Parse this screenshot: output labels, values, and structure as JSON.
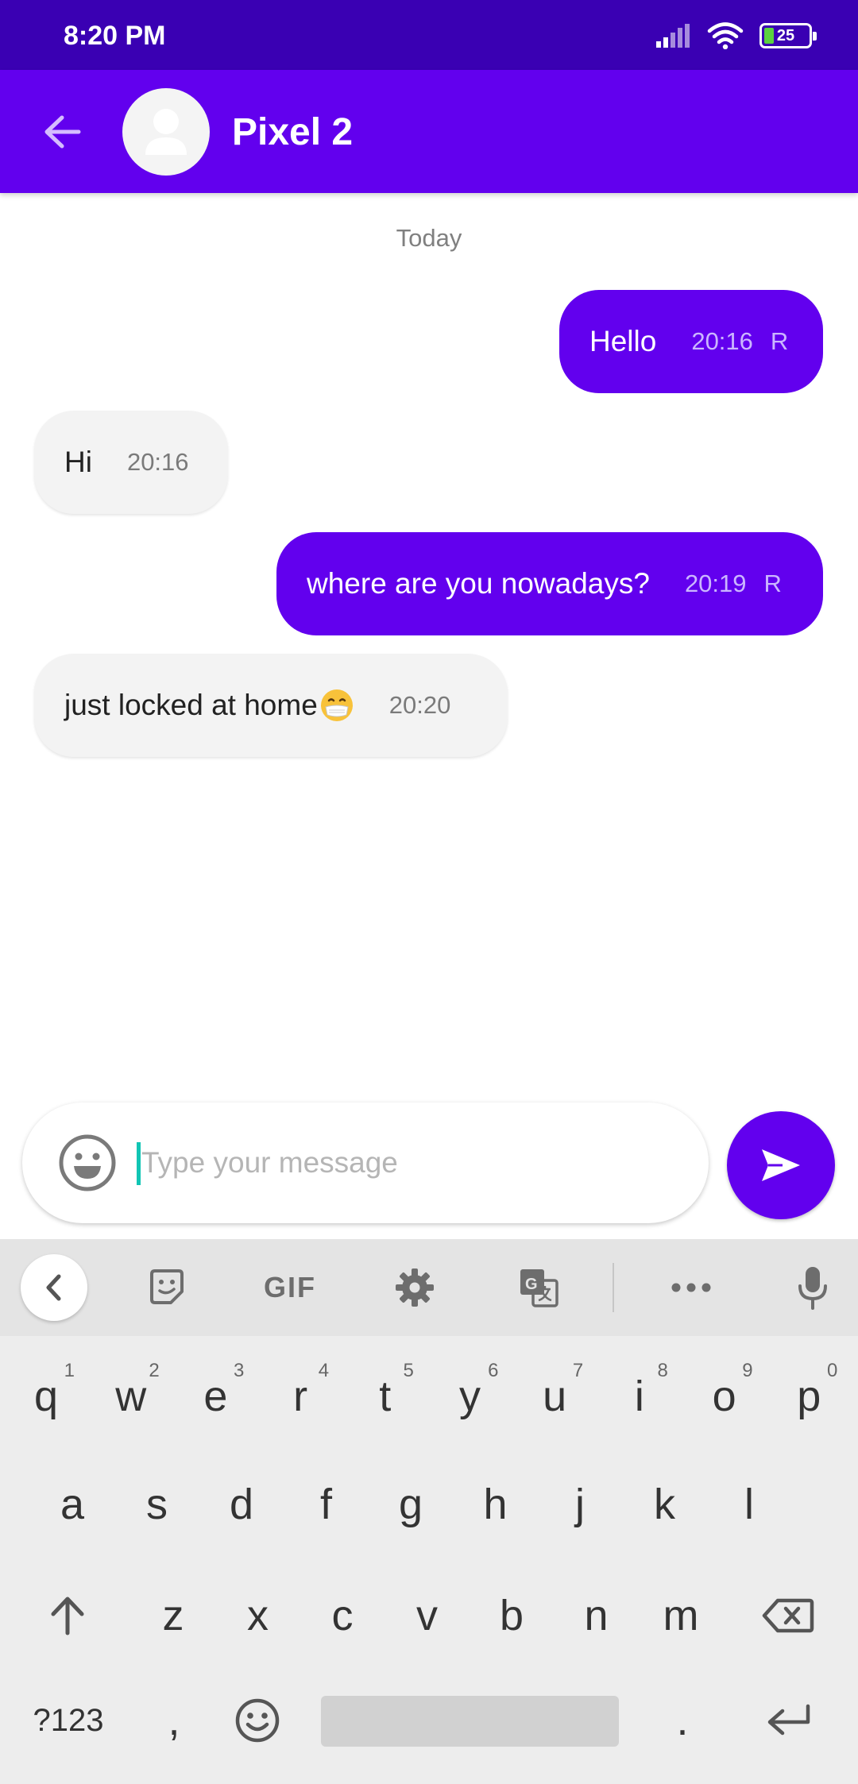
{
  "status_bar": {
    "time": "8:20 PM",
    "battery": "25"
  },
  "header": {
    "contact_name": "Pixel 2"
  },
  "chat": {
    "date_separator": "Today",
    "messages": [
      {
        "direction": "out",
        "text": "Hello",
        "time": "20:16",
        "status": "R"
      },
      {
        "direction": "in",
        "text": "Hi",
        "time": "20:16"
      },
      {
        "direction": "out",
        "text": "where are you nowadays?",
        "time": "20:19",
        "status": "R"
      },
      {
        "direction": "in",
        "text": "just locked at home",
        "emoji": "face-with-medical-mask",
        "time": "20:20"
      }
    ]
  },
  "composer": {
    "placeholder": "Type your message",
    "value": ""
  },
  "keyboard": {
    "toolbar": {
      "gif_label": "GIF"
    },
    "row1": [
      {
        "key": "q",
        "hint": "1"
      },
      {
        "key": "w",
        "hint": "2"
      },
      {
        "key": "e",
        "hint": "3"
      },
      {
        "key": "r",
        "hint": "4"
      },
      {
        "key": "t",
        "hint": "5"
      },
      {
        "key": "y",
        "hint": "6"
      },
      {
        "key": "u",
        "hint": "7"
      },
      {
        "key": "i",
        "hint": "8"
      },
      {
        "key": "o",
        "hint": "9"
      },
      {
        "key": "p",
        "hint": "0"
      }
    ],
    "row2": [
      "a",
      "s",
      "d",
      "f",
      "g",
      "h",
      "j",
      "k",
      "l"
    ],
    "row3": [
      "z",
      "x",
      "c",
      "v",
      "b",
      "n",
      "m"
    ],
    "bottom": {
      "symbols": "?123",
      "comma": ",",
      "period": "."
    }
  },
  "colors": {
    "primary": "#6200ee",
    "status_bar": "#3a00b3",
    "incoming_bubble": "#f3f3f3",
    "caret": "#11c5b4"
  }
}
